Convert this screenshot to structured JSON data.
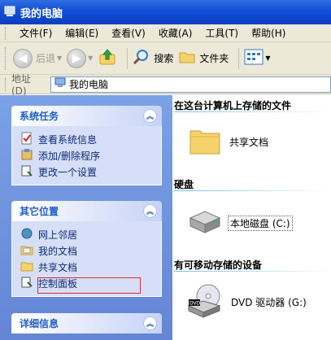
{
  "window": {
    "title": "我的电脑"
  },
  "menu": [
    "文件(F)",
    "编辑(E)",
    "查看(V)",
    "收藏(A)",
    "工具(T)",
    "帮助(H)"
  ],
  "toolbar": {
    "back_label": "后退",
    "search_label": "搜索",
    "folders_label": "文件夹"
  },
  "address": {
    "label": "地址(D)",
    "value": "我的电脑"
  },
  "left_panels": {
    "system_tasks": {
      "title": "系统任务",
      "items": [
        "查看系统信息",
        "添加/删除程序",
        "更改一个设置"
      ]
    },
    "other_places": {
      "title": "其它位置",
      "items": [
        "网上邻居",
        "我的文档",
        "共享文档",
        "控制面板"
      ]
    },
    "details": {
      "title": "详细信息"
    }
  },
  "main": {
    "sections": [
      {
        "title": "在这台计算机上存储的文件",
        "items": [
          "共享文档"
        ]
      },
      {
        "title": "硬盘",
        "items": [
          "本地磁盘 (C:)"
        ]
      },
      {
        "title": "有可移动存储的设备",
        "items": [
          "DVD 驱动器 (G:)"
        ]
      }
    ]
  },
  "colors": {
    "title_bar": "#1550d8",
    "left_pane": "#6e93dc",
    "panel_title": "#215dc6",
    "highlight_box": "#e0283a"
  }
}
